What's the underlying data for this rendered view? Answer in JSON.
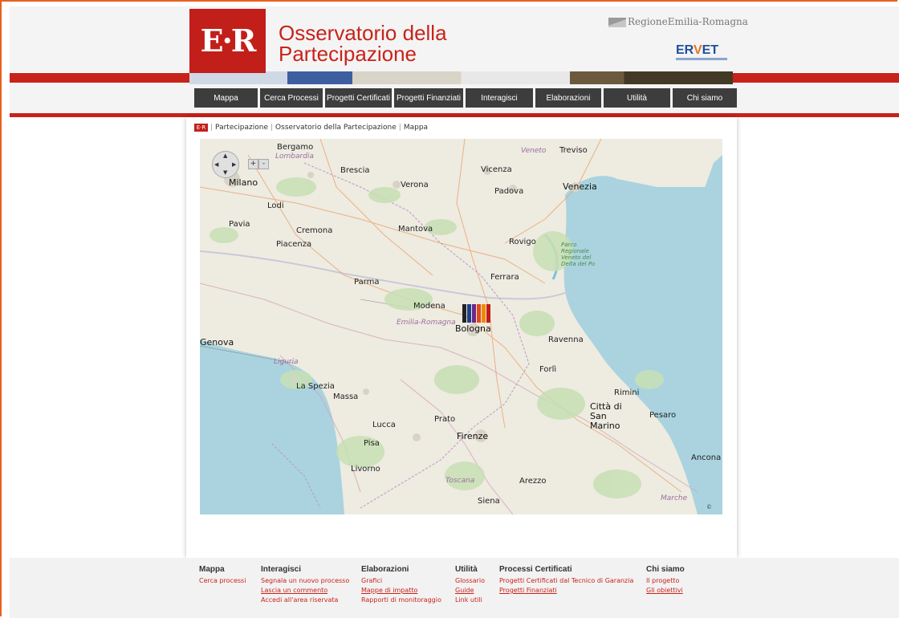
{
  "header": {
    "logo": "E·R",
    "title_line1": "Osservatorio della",
    "title_line2": "Partecipazione",
    "region_logo": "RegioneEmilia-Romagna",
    "ervet_logo_a": "ER",
    "ervet_logo_b": "V",
    "ervet_logo_c": "ET"
  },
  "nav": {
    "items": [
      "Mappa",
      "Cerca Processi",
      "Progetti Certificati",
      "Progetti Finanziati",
      "Interagisci",
      "Elaborazioni",
      "Utilità",
      "Chi siamo"
    ]
  },
  "breadcrumb": {
    "home": "E·R",
    "items": [
      "Partecipazione",
      "Osservatorio della Partecipazione",
      "Mappa"
    ]
  },
  "map": {
    "labels": [
      "Bergamo",
      "Lombardia",
      "Brescia",
      "Veneto",
      "Treviso",
      "Milano",
      "Lodi",
      "Vicenza",
      "Verona",
      "Padova",
      "Venezia",
      "Pavia",
      "Cremona",
      "Piacenza",
      "Mantova",
      "Rovigo",
      "Parco Regionale Veneto del Delta del Po",
      "Ferrara",
      "Parma",
      "Modena",
      "Emilia-Romagna",
      "Bologna",
      "Ravenna",
      "Genova",
      "Forlì",
      "Liguria",
      "La Spezia",
      "Massa",
      "Rimini",
      "Città di San Marino",
      "Pesaro",
      "Lucca",
      "Prato",
      "Firenze",
      "Pisa",
      "Livorno",
      "Toscana",
      "Arezzo",
      "Ancona",
      "Siena",
      "Marche"
    ],
    "zoom_in": "+",
    "zoom_out": "-",
    "attribution": "©",
    "marker_colors": [
      "#222222",
      "#1f3e8c",
      "#6a2a8a",
      "#e04a1c",
      "#f08a00",
      "#c41a1a"
    ]
  },
  "footer": {
    "mappa": {
      "title": "Mappa",
      "links": [
        "Cerca processi"
      ]
    },
    "interagisci": {
      "title": "Interagisci",
      "links": [
        "Segnala un nuovo processo",
        "Lascia un commento",
        "Accedi all'area riservata"
      ]
    },
    "elaborazioni": {
      "title": "Elaborazioni",
      "links": [
        "Grafici",
        "Mappe di impatto",
        "Rapporti di monitoraggio"
      ]
    },
    "utilita": {
      "title": "Utilità",
      "links": [
        "Glossario",
        "Guide",
        "Link utili"
      ]
    },
    "processi": {
      "title": "Processi Certificati",
      "links": [
        "Progetti Certificati dal Tecnico di Garanzia",
        "Progetti Finanziati"
      ]
    },
    "chisiamo": {
      "title": "Chi siamo",
      "links": [
        "Il progetto",
        "Gli obiettivi"
      ]
    }
  },
  "colors": {
    "brand_red": "#c8231b",
    "nav_bg": "#3d3d3d",
    "frame_orange": "#e8601f"
  }
}
